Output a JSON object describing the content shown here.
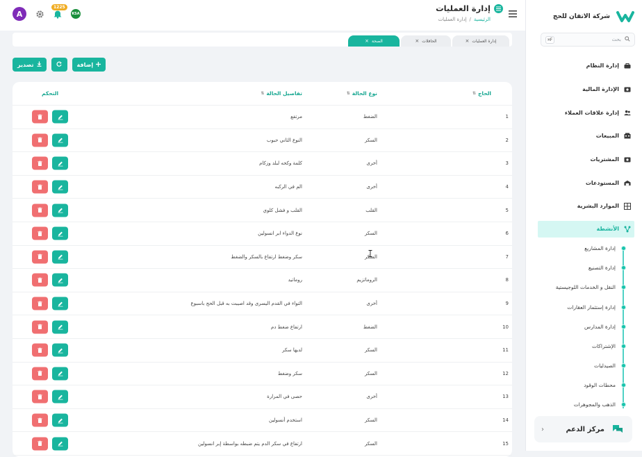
{
  "brand": {
    "name": "شركة الاتقان للحج"
  },
  "sidebar": {
    "search_placeholder": "بحث",
    "search_shortcut": "F⌘",
    "menu": [
      {
        "label": "إدارة النظام",
        "icon": "system-icon"
      },
      {
        "label": "الإدارة المالية",
        "icon": "finance-icon"
      },
      {
        "label": "إدارة علاقات العملاء",
        "icon": "users-icon"
      },
      {
        "label": "المبيعات",
        "icon": "sales-icon"
      },
      {
        "label": "المشتريات",
        "icon": "purchases-icon"
      },
      {
        "label": "المستودعات",
        "icon": "warehouse-icon"
      },
      {
        "label": "الموارد البشرية",
        "icon": "hr-icon"
      },
      {
        "label": "الأنشطة",
        "icon": "activities-icon",
        "active": true
      }
    ],
    "submenu": [
      "إدارة المشاريع",
      "إدارة التصنيع",
      "النقل و الخدمات اللوجيستية",
      "إدارة إستثمار العقارات",
      "إدارة المدارس",
      "الإشتراكات",
      "الصيدليات",
      "محطات الوقود",
      "الذهب والمجوهرات"
    ],
    "support_label": "مركز الدعم"
  },
  "header": {
    "title": "إدارة العمليات",
    "breadcrumb_home": "الرئيسية",
    "breadcrumb_sep": "/",
    "breadcrumb_current": "إدارة العمليات",
    "avatar_letter": "A",
    "notifications_badge": "1225",
    "language_flag": "KSA"
  },
  "tabs": [
    {
      "label": "إدارة العمليات",
      "active": false
    },
    {
      "label": "الحافلات",
      "active": false
    },
    {
      "label": "الصحة",
      "active": true
    }
  ],
  "toolbar": {
    "add_label": "إضافة",
    "export_label": "تصدير"
  },
  "table": {
    "headers": {
      "pilgrim": "الحاج",
      "type": "نوع الحالة",
      "details": "تفاصيل الحالة",
      "control": "التحكم"
    },
    "rows": [
      {
        "num": "1",
        "type": "الضغط",
        "details": "مرتفع"
      },
      {
        "num": "2",
        "type": "السكر",
        "details": "النوع الثاني حبوب"
      },
      {
        "num": "3",
        "type": "أخرى",
        "details": "كلمة وكحه لبلد وزكام"
      },
      {
        "num": "4",
        "type": "أخرى",
        "details": "الم في الركبه"
      },
      {
        "num": "5",
        "type": "القلب",
        "details": "القلب و فشل كلوي"
      },
      {
        "num": "6",
        "type": "السكر",
        "details": "نوع الدواء ابر انسولين"
      },
      {
        "num": "7",
        "type": "السكر",
        "details": "سكر وضغط ارتفاع بالسكر والضغط"
      },
      {
        "num": "8",
        "type": "الروماتزيم",
        "details": "روماتيد"
      },
      {
        "num": "9",
        "type": "أخرى",
        "details": "التواء في القدم اليسرى وقد اصيبت به قبل الحج باسبوع"
      },
      {
        "num": "10",
        "type": "الضغط",
        "details": "ارتفاع ضغط دم"
      },
      {
        "num": "11",
        "type": "السكر",
        "details": "لديها سكر"
      },
      {
        "num": "12",
        "type": "السكر",
        "details": "سكر وضغط"
      },
      {
        "num": "13",
        "type": "أخرى",
        "details": "حصى في المرارة"
      },
      {
        "num": "14",
        "type": "السكر",
        "details": "استخدم أنسولين"
      },
      {
        "num": "15",
        "type": "السكر",
        "details": "ارتفاع في سكر الدم يتم ضبطه بواسطة إبر انسولين"
      }
    ]
  },
  "colors": {
    "accent": "#19b59e",
    "danger": "#f06f71",
    "avatar": "#7f2bb8",
    "badge": "#f0ad24"
  }
}
